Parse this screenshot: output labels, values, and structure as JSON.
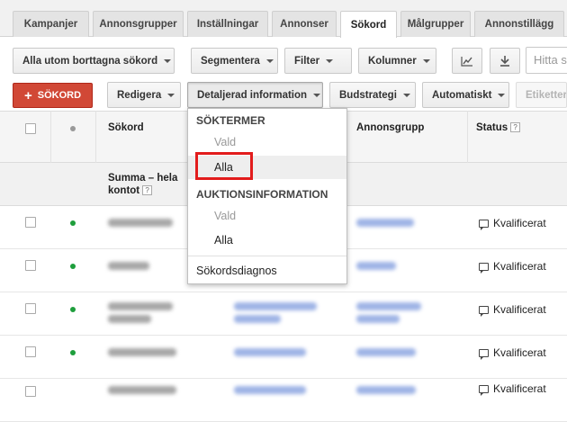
{
  "tabs": [
    "Kampanjer",
    "Annonsgrupper",
    "Inställningar",
    "Annonser",
    "Sökord",
    "Målgrupper",
    "Annonstillägg"
  ],
  "active_tab": "Sökord",
  "toolbar1": {
    "filter_view": "Alla utom borttagna sökord",
    "segment": "Segmentera",
    "filter": "Filter",
    "columns": "Kolumner",
    "chart_icon": "line-chart-icon",
    "download_icon": "download-icon",
    "search_placeholder": "Hitta s"
  },
  "toolbar2": {
    "add_keyword": "SÖKORD",
    "edit": "Redigera",
    "details": "Detaljerad information",
    "bid_strategy": "Budstrategi",
    "automatic": "Automatiskt",
    "labels": "Etiketter"
  },
  "table": {
    "headers": {
      "keyword": "Sökord",
      "ad_group": "Annonsgrupp",
      "status": "Status"
    },
    "help_glyph": "?",
    "summary_label": "Summa – hela kontot",
    "rows": [
      {
        "status": "Kvalificerat",
        "dot_color": "#1e9e3c"
      },
      {
        "status": "Kvalificerat",
        "dot_color": "#1e9e3c"
      },
      {
        "status": "Kvalificerat",
        "dot_color": "#1e9e3c"
      },
      {
        "status": "Kvalificerat",
        "dot_color": "#1e9e3c"
      },
      {
        "status": "Kvalificerat",
        "dot_color": "#1e9e3c"
      }
    ]
  },
  "dropdown": {
    "section1": "SÖKTERMER",
    "section1_selected": "Vald",
    "section1_all": "Alla",
    "section2": "AUKTIONSINFORMATION",
    "section2_selected": "Vald",
    "section2_all": "Alla",
    "diagnosis": "Sökordsdiagnos"
  },
  "colors": {
    "accent_red": "#d14836",
    "highlight_red": "#e21c1c",
    "status_green": "#1e9e3c"
  }
}
